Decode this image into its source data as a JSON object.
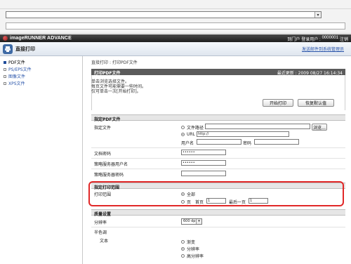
{
  "product": {
    "name": "imageRUNNER ADVANCE",
    "portal_link": "到门户",
    "login_label": "登录用户 : ",
    "user_id": "0000001",
    "logout": "注销"
  },
  "subheader": {
    "title": "直接打印",
    "admin_link": "发送邮件到系统管理员"
  },
  "sidebar": {
    "items": [
      {
        "label": "PDF文件",
        "active": true
      },
      {
        "label": "PS/EPS文件",
        "active": false
      },
      {
        "label": "图像文件",
        "active": false
      },
      {
        "label": "XPS文件",
        "active": false
      }
    ]
  },
  "breadcrumb": {
    "root": "直接打印",
    "sep": ":",
    "current": "打印PDF文件"
  },
  "panel": {
    "title": "打印PDF文件",
    "last_updated_label": "最近更新",
    "last_updated_value": "2009 08/27 16:14:34",
    "info": [
      "单击浏览选择文件。",
      "每页文件可能需要一些时间。",
      "仅可单击一次[开始打印]。"
    ],
    "start_button": "开始打印",
    "reset_button": "恢复默认值"
  },
  "file_section": {
    "title": "指定PDF文件",
    "specify_label": "指定文件",
    "path_option": "文件路径",
    "path_value": "",
    "browse_button": "浏览...",
    "url_option": "URL",
    "url_value": "http://",
    "username_label": "用户名",
    "username_value": "",
    "password_label": "密码",
    "password_value": "",
    "doc_password_label": "文档密码",
    "doc_password_value": "••••••",
    "policy_user_label": "策略服务器用户名",
    "policy_user_value": "••••••",
    "policy_pass_label": "策略服务器密码",
    "policy_pass_value": ""
  },
  "range_section": {
    "title": "指定打印范围",
    "range_label": "打印范围",
    "all_option": "全部",
    "pages_option": "页",
    "first_label": "首页",
    "first_value": "1",
    "last_label": "最后一页",
    "last_value": "1"
  },
  "quality_section": {
    "title": "质量设置",
    "resolution_label": "分辨率",
    "resolution_value": "600 dpi",
    "halftone_label": "半色调",
    "text_label": "文本",
    "text_options": [
      "渐变",
      "分辨率",
      "高分辨率"
    ],
    "text_selected": "分辨率"
  },
  "colors": {
    "highlight": "#e12727",
    "link": "#2a55aa",
    "section_header": "#5b5b5b"
  }
}
